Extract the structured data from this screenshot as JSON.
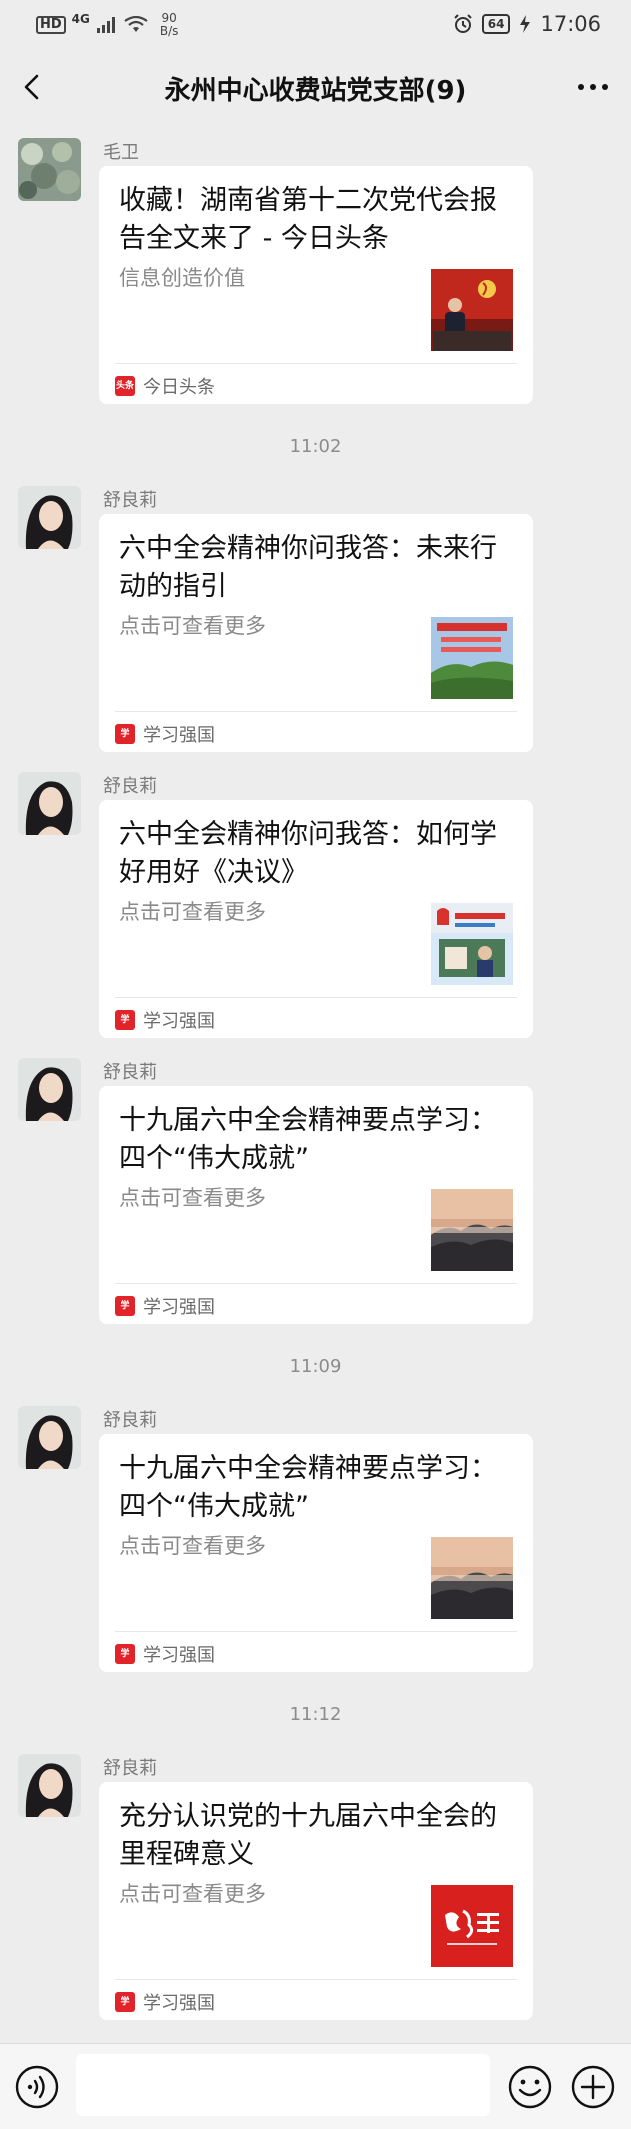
{
  "status_bar": {
    "hd": "HD",
    "network": "4G",
    "speed_value": "90",
    "speed_unit": "B/s",
    "battery": "64",
    "time": "17:06"
  },
  "nav": {
    "title": "永州中心收费站党支部(9)",
    "back_icon": "chevron-left-icon",
    "more_icon": "more-dots-icon"
  },
  "messages": [
    {
      "sender": "毛卫",
      "title": "收藏！湖南省第十二次党代会报告全文来了 - 今日头条",
      "desc": "信息创造价值",
      "source": "今日头条",
      "source_icon": "头条",
      "thumbnail": "party-congress-photo"
    },
    {
      "time": "11:02",
      "sender": "舒良莉",
      "title": "六中全会精神你问我答：未来行动的指引",
      "desc": "点击可查看更多",
      "source": "学习强国",
      "source_icon": "学",
      "thumbnail": "mountain-forest-photo"
    },
    {
      "sender": "舒良莉",
      "title": "六中全会精神你问我答：如何学好用好《决议》",
      "desc": "点击可查看更多",
      "source": "学习强国",
      "source_icon": "学",
      "thumbnail": "study-session-graphic"
    },
    {
      "sender": "舒良莉",
      "title": "十九届六中全会精神要点学习：四个“伟大成就”",
      "desc": "点击可查看更多",
      "source": "学习强国",
      "source_icon": "学",
      "thumbnail": "misty-mountains-photo"
    },
    {
      "time": "11:09",
      "sender": "舒良莉",
      "title": "十九届六中全会精神要点学习：四个“伟大成就”",
      "desc": "点击可查看更多",
      "source": "学习强国",
      "source_icon": "学",
      "thumbnail": "misty-mountains-photo"
    },
    {
      "time": "11:12",
      "sender": "舒良莉",
      "title": "充分认识党的十九届六中全会的里程碑意义",
      "desc": "点击可查看更多",
      "source": "学习强国",
      "source_icon": "学",
      "thumbnail": "xuexi-qiangguo-logo"
    }
  ],
  "input_bar": {
    "voice_icon": "voice-icon",
    "emoji_icon": "emoji-icon",
    "plus_icon": "plus-circle-icon"
  },
  "colors": {
    "background": "#ededed",
    "card": "#ffffff",
    "source_red": "#e0242a"
  }
}
